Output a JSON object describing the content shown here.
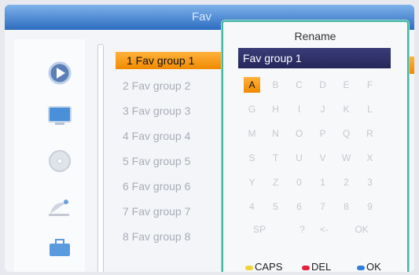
{
  "window": {
    "title": "Fav"
  },
  "sidebar": {
    "icons": [
      "play-icon",
      "tv-icon",
      "disc-icon",
      "satellite-dish-icon",
      "toolbox-icon"
    ]
  },
  "fav_list": {
    "items": [
      {
        "label": "1 Fav group 1",
        "selected": true
      },
      {
        "label": "2 Fav group 2"
      },
      {
        "label": "3 Fav group 3"
      },
      {
        "label": "4 Fav group 4"
      },
      {
        "label": "5 Fav group 5"
      },
      {
        "label": "6 Fav group 6"
      },
      {
        "label": "7 Fav group 7"
      },
      {
        "label": "8 Fav group 8"
      }
    ]
  },
  "rename_dialog": {
    "title": "Rename",
    "name_value": "Fav group 1",
    "keyboard": {
      "rows": [
        [
          "A",
          "B",
          "C",
          "D",
          "E",
          "F"
        ],
        [
          "G",
          "H",
          "I",
          "J",
          "K",
          "L"
        ],
        [
          "M",
          "N",
          "O",
          "P",
          "Q",
          "R"
        ],
        [
          "S",
          "T",
          "U",
          "V",
          "W",
          "X"
        ],
        [
          "Y",
          "Z",
          "0",
          "1",
          "2",
          "3"
        ],
        [
          "4",
          "5",
          "6",
          "7",
          "8",
          "9"
        ]
      ],
      "bottom": {
        "space": "SP",
        "question": "?",
        "back": "<-",
        "ok": "OK"
      },
      "selected": "A"
    },
    "legend": {
      "caps": {
        "label": "CAPS",
        "color": "#f2d23a"
      },
      "del": {
        "label": "DEL",
        "color": "#e0223a"
      },
      "ok": {
        "label": "OK",
        "color": "#2f7fe0"
      }
    }
  },
  "colors": {
    "title_bar": "#2c6cc0",
    "accent_orange": "#f08a00",
    "dialog_border": "#40b8a4"
  }
}
